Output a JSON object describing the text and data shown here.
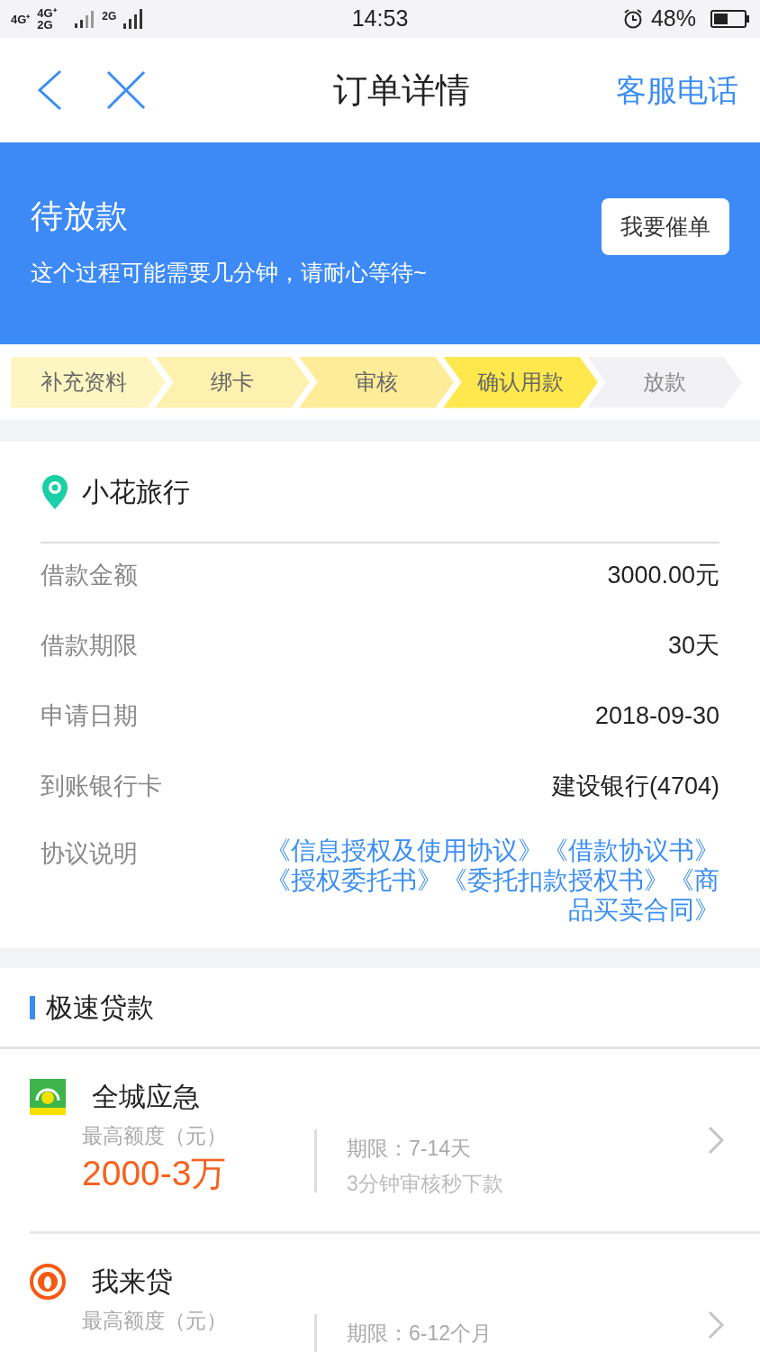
{
  "status_bar": {
    "network_1": "4G⁺",
    "network_2": "4G⁺ 2G",
    "network_3": "2G",
    "time": "14:53",
    "battery": "48%",
    "level": 0.48
  },
  "nav": {
    "title": "订单详情",
    "action": "客服电话"
  },
  "banner": {
    "title": "待放款",
    "message": "这个过程可能需要几分钟，请耐心等待~",
    "button": "我要催单"
  },
  "steps": [
    {
      "label": "补充资料",
      "completed": true,
      "current": false
    },
    {
      "label": "绑卡",
      "completed": true,
      "current": false
    },
    {
      "label": "审核",
      "completed": true,
      "current": false
    },
    {
      "label": "确认用款",
      "completed": true,
      "current": true
    },
    {
      "label": "放款",
      "completed": false,
      "current": false
    }
  ],
  "order": {
    "merchant": "小花旅行",
    "rows": [
      {
        "label": "借款金额",
        "value": "3000.00元"
      },
      {
        "label": "借款期限",
        "value": "30天"
      },
      {
        "label": "申请日期",
        "value": "2018-09-30"
      },
      {
        "label": "到账银行卡",
        "value": "建设银行(4704)"
      }
    ],
    "agreements_label": "协议说明",
    "agreements": [
      "《信息授权及使用协议》",
      "《借款协议书》",
      "《授权委托书》",
      "《委托扣款授权书》",
      "《商品买卖合同》"
    ]
  },
  "section_title": "极速贷款",
  "products": [
    {
      "name": "全城应急",
      "kind": "shield",
      "amount_label": "最高额度（元）",
      "amount": "2000-3万",
      "term": "期限：7-14天",
      "note": "3分钟审核秒下款"
    },
    {
      "name": "我来贷",
      "kind": "ring",
      "amount_label": "最高额度（元）",
      "term": "期限：6-12个月"
    }
  ]
}
